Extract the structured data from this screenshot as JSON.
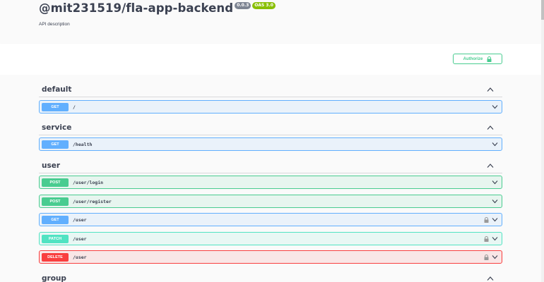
{
  "info": {
    "title": "@mit231519/fla-app-backend",
    "version": "0.0.3",
    "oas": "OAS 3.0",
    "description": "API description"
  },
  "authorize": {
    "label": "Authorize",
    "icon": "lock-icon",
    "color": "#49cc90"
  },
  "tags": [
    {
      "name": "default",
      "expanded": true
    },
    {
      "name": "service",
      "expanded": true
    },
    {
      "name": "user",
      "expanded": true
    },
    {
      "name": "group",
      "expanded": true
    }
  ],
  "operations": [
    {
      "tag": "default",
      "method": "GET",
      "path": "/",
      "locked": false
    },
    {
      "tag": "service",
      "method": "GET",
      "path": "/health",
      "locked": false
    },
    {
      "tag": "user",
      "method": "POST",
      "path": "/user/login",
      "locked": false
    },
    {
      "tag": "user",
      "method": "POST",
      "path": "/user/register",
      "locked": false
    },
    {
      "tag": "user",
      "method": "GET",
      "path": "/user",
      "locked": true
    },
    {
      "tag": "user",
      "method": "PATCH",
      "path": "/user",
      "locked": true
    },
    {
      "tag": "user",
      "method": "DELETE",
      "path": "/user",
      "locked": true
    }
  ],
  "colors": {
    "get": "#61affe",
    "post": "#49cc90",
    "patch": "#50e3c2",
    "delete": "#f93e3e"
  }
}
